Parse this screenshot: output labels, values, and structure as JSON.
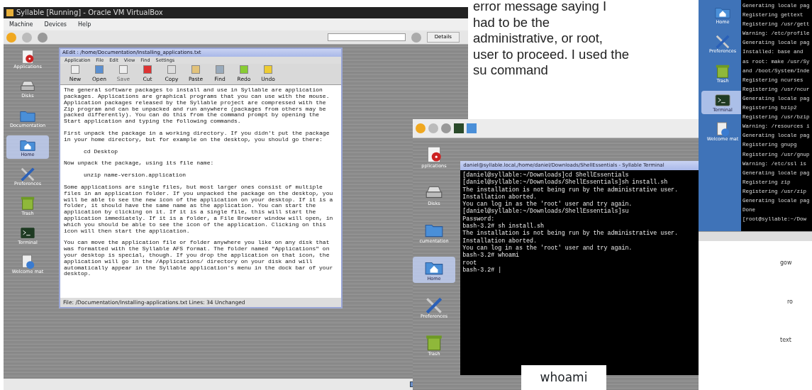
{
  "vbox_window": {
    "title": "Syllable [Running] - Oracle VM VirtualBox",
    "menu": [
      "Machine",
      "Devices",
      "Help"
    ],
    "details_button": "Details",
    "desktop_icons": [
      {
        "label": "Applications",
        "selected": false
      },
      {
        "label": "Disks",
        "selected": false
      },
      {
        "label": "Documentation",
        "selected": false
      },
      {
        "label": "Home",
        "selected": true
      },
      {
        "label": "Preferences",
        "selected": false
      },
      {
        "label": "Trash",
        "selected": false
      },
      {
        "label": "Terminal",
        "selected": false
      },
      {
        "label": "Welcome mat",
        "selected": false
      }
    ],
    "editor": {
      "title": "AEdit : /home/Documentation/Installing_applications.txt",
      "menu": [
        "Application",
        "File",
        "Edit",
        "View",
        "Find",
        "Settings"
      ],
      "toolbar": [
        {
          "label": "New",
          "disabled": false
        },
        {
          "label": "Open",
          "disabled": false
        },
        {
          "label": "Save",
          "disabled": true
        },
        {
          "label": "Cut",
          "disabled": false
        },
        {
          "label": "Copy",
          "disabled": false
        },
        {
          "label": "Paste",
          "disabled": false
        },
        {
          "label": "Find",
          "disabled": false
        },
        {
          "label": "Redo",
          "disabled": false
        },
        {
          "label": "Undo",
          "disabled": false
        }
      ],
      "paragraphs": [
        {
          "kind": "text",
          "text": "The general software packages to install and use in Syllable are application packages. Applications are graphical programs that you can use with the mouse. Application packages released by the Syllable project are compressed with the Zip program and can be unpacked and run anywhere (packages from others may be packed differently). You can do this from the command prompt by opening the Start application and typing the following commands."
        },
        {
          "kind": "text",
          "text": "First unpack the package in a working directory. If you didn't put the package in your home directory, but for example on the desktop, you should go there:"
        },
        {
          "kind": "code",
          "text": "cd Desktop"
        },
        {
          "kind": "text",
          "text": "Now unpack the package, using its file name:"
        },
        {
          "kind": "code",
          "text": "unzip name-version.application"
        },
        {
          "kind": "text",
          "text": "Some applications are single files, but most larger ones consist of multiple files in an application folder. If you unpacked the package on the desktop, you will be able to see the new icon of the application on your desktop. If it is a folder, it should have the same name as the application. You can start the application by clicking on it. If it is a single file, this will start the application immediately. If it is a folder, a File Browser window will open, in which you should be able to see the icon of the application. Clicking on this icon will then start the application."
        },
        {
          "kind": "text",
          "text": "You can move the application file or folder anywhere you like on any disk that was formatted with the Syllable AFS format. The folder named \"Applications\" on your desktop is special, though. If you drop the application on that icon, the application will go in the /Applications/ directory on your disk and will automatically appear in the Syllable application's menu in the dock bar of your desktop."
        }
      ],
      "status": "File: /Documentation/Installing-applications.txt  Lines: 34  Unchanged"
    }
  },
  "note": "error message saying I had to be the administrative, or root, user to proceed. I used the su command",
  "second_screenshot": {
    "desktop_icons": [
      {
        "label": "pplications",
        "selected": false
      },
      {
        "label": "Disks",
        "selected": false
      },
      {
        "label": "cumentation",
        "selected": false
      },
      {
        "label": "Home",
        "selected": true
      },
      {
        "label": "Preferences",
        "selected": false
      },
      {
        "label": "Trash",
        "selected": false
      }
    ],
    "terminal": {
      "title": "daniel@syllable.local,/home/daniel/Downloads/ShellEssentials - Syllable Terminal",
      "lines": [
        "[daniel@syllable:~/Downloads]cd ShellEssentials",
        "[daniel@syllable:~/Downloads/ShellEssentials]sh install.sh",
        "The installation is not being run by the administrative user.",
        "Installation aborted.",
        "You can log in as the 'root' user and try again.",
        "[daniel@syllable:~/Downloads/ShellEssentials]su",
        "Password:",
        "bash-3.2# sh install.sh",
        "The installation is not being run by the administrative user.",
        "Installation aborted.",
        "You can log in as the 'root' user and try again.",
        "bash-3.2# whoami",
        "root",
        "bash-3.2# |"
      ]
    }
  },
  "caption": "whoami",
  "right_screenshot": {
    "dock_items": [
      {
        "label": "Home",
        "selected": false
      },
      {
        "label": "Preferences",
        "selected": false
      },
      {
        "label": "Trash",
        "selected": false
      },
      {
        "label": "Terminal",
        "selected": true
      },
      {
        "label": "Welcome mat",
        "selected": false
      }
    ],
    "terminal_lines": [
      "Generating locale pag",
      "Registering gettext",
      "Registering /usr/gett",
      "Warning: /etc/profile",
      "Generating locale pag",
      "Installed: base and",
      "as root: make /usr/Sy",
      "and /boot/System/Inde",
      "Registering ncurses",
      "Registering /usr/ncur",
      "Generating locale pag",
      "Registering bzip2",
      "Registering /usr/bzip",
      "Warning: /resources i",
      "Generating locale pag",
      "Registering gnupg",
      "Registering /usr/gnup",
      "Warning: /etc/ssl is",
      "Generating locale pag",
      "Registering zip",
      "Registering /usr/zip",
      "Generating locale pag",
      "Done",
      "[root@syllable:~/Dow"
    ]
  },
  "fragments": [
    "gow",
    "ro",
    "text"
  ]
}
